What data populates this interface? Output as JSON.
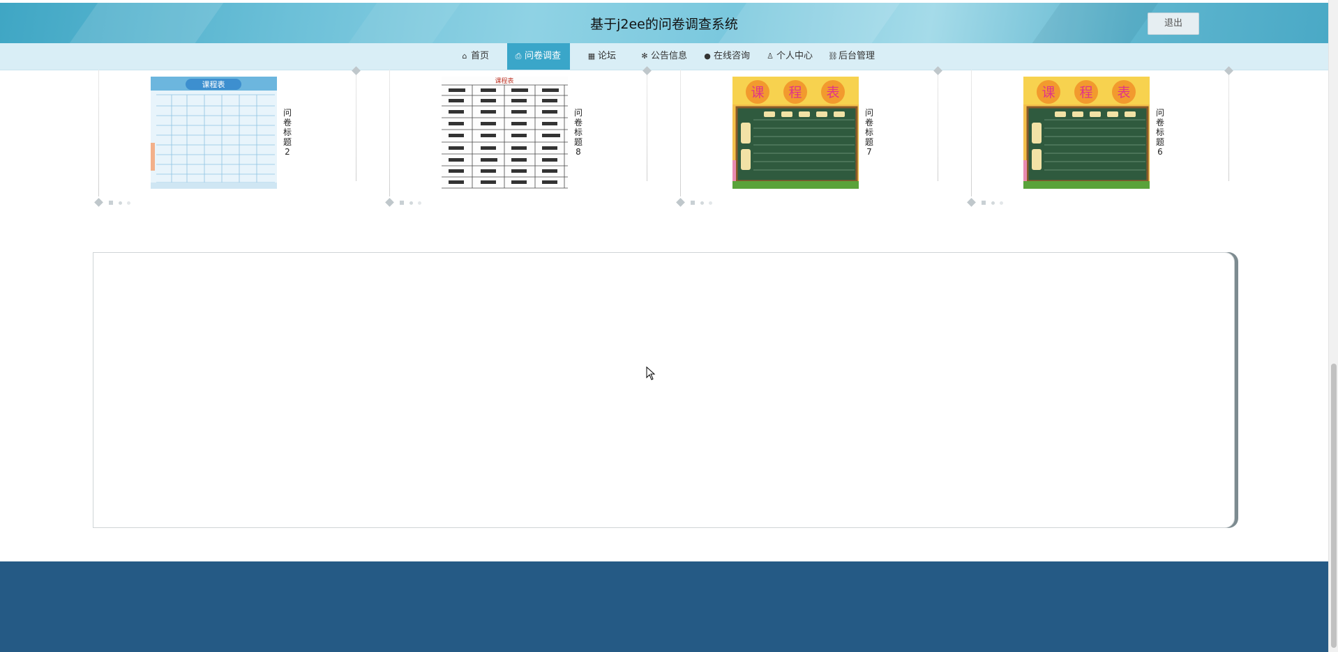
{
  "header": {
    "title": "基于j2ee的问卷调查系统",
    "logout_label": "退出"
  },
  "nav": {
    "items": [
      {
        "label": "首页",
        "icon": "home-icon",
        "active": false
      },
      {
        "label": "问卷调查",
        "icon": "print-icon",
        "active": true
      },
      {
        "label": "论坛",
        "icon": "grid-icon",
        "active": false
      },
      {
        "label": "公告信息",
        "icon": "snowflake-icon",
        "active": false
      },
      {
        "label": "在线咨询",
        "icon": "chat-icon",
        "active": false
      },
      {
        "label": "个人中心",
        "icon": "user-icon",
        "active": false
      },
      {
        "label": "后台管理",
        "icon": "link-icon",
        "active": false
      }
    ]
  },
  "surveys": [
    {
      "title": "问卷标题2",
      "image": "blue-timetable-thumbnail"
    },
    {
      "title": "问卷标题8",
      "image": "handwritten-timetable-thumbnail"
    },
    {
      "title": "问卷标题7",
      "image": "chalkboard-timetable-thumbnail"
    },
    {
      "title": "问卷标题6",
      "image": "chalkboard-timetable-thumbnail"
    }
  ],
  "thumbnails": {
    "blue_title": "课程表",
    "handwritten_title": "课程表",
    "chalk_chars": [
      "课",
      "程",
      "表"
    ]
  },
  "colors": {
    "header_accent": "#4aa9c6",
    "nav_background": "#d9eef6",
    "nav_active": "#3aa6c9",
    "footer": "#255a85"
  }
}
